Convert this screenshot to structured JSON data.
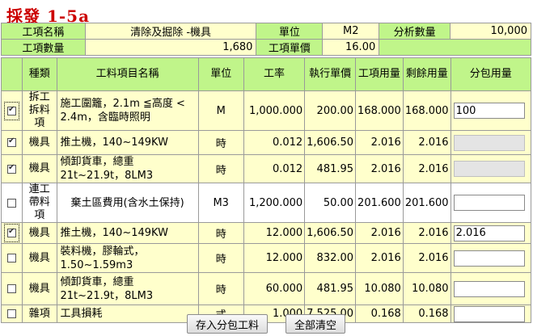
{
  "title": "採發 1-5a",
  "header": {
    "row1": {
      "item_name_label": "工項名稱",
      "item_name": "清除及掘除 -機具",
      "unit_label": "單位",
      "unit": "M2",
      "analysis_qty_label": "分析數量",
      "analysis_qty": "10,000"
    },
    "row2": {
      "item_qty_label": "工項數量",
      "item_qty": "1,680",
      "unit_price_label": "工項單價",
      "unit_price": "16.00"
    }
  },
  "columns": [
    "",
    "種類",
    "工料項目名稱",
    "單位",
    "工率",
    "執行單價",
    "工項用量",
    "剩餘用量",
    "分包用量"
  ],
  "rows": [
    {
      "checked": true,
      "focus": true,
      "kind": "拆工拆料項",
      "name": "施工圍籬，2.1m ≦高度 < 2.4m，含臨時照明",
      "unit": "M",
      "rate": "1,000.000",
      "price": "200.00",
      "usage": "168.000",
      "remain": "168.000",
      "sub": "100",
      "disabled": false,
      "alt": false
    },
    {
      "checked": true,
      "focus": false,
      "kind": "機具",
      "name": "推土機，140~149KW",
      "unit": "時",
      "rate": "0.012",
      "price": "1,606.50",
      "usage": "2.016",
      "remain": "2.016",
      "sub": "",
      "disabled": true,
      "alt": false
    },
    {
      "checked": true,
      "focus": false,
      "kind": "機具",
      "name": "傾卸貨車，總重21t~21.9t，8LM3",
      "unit": "時",
      "rate": "0.012",
      "price": "481.95",
      "usage": "2.016",
      "remain": "2.016",
      "sub": "",
      "disabled": true,
      "alt": false
    },
    {
      "checked": false,
      "focus": false,
      "kind": "連工帶料項",
      "name": "棄土區費用(含水土保持)",
      "unit": "M3",
      "rate": "1,200.000",
      "price": "50.00",
      "usage": "201.600",
      "remain": "201.600",
      "sub": "",
      "disabled": false,
      "alt": true,
      "center": true
    },
    {
      "checked": true,
      "focus": true,
      "kind": "機具",
      "name": "推土機，140~149KW",
      "unit": "時",
      "rate": "12.000",
      "price": "1,606.50",
      "usage": "2.016",
      "remain": "2.016",
      "sub": "2.016",
      "disabled": false,
      "alt": false
    },
    {
      "checked": false,
      "focus": false,
      "kind": "機具",
      "name": "裝料機，膠輪式，1.50~1.59m3",
      "unit": "時",
      "rate": "12.000",
      "price": "832.00",
      "usage": "2.016",
      "remain": "2.016",
      "sub": "",
      "disabled": false,
      "alt": false
    },
    {
      "checked": false,
      "focus": false,
      "kind": "機具",
      "name": "傾卸貨車，總重21t~21.9t，8LM3",
      "unit": "時",
      "rate": "60.000",
      "price": "481.95",
      "usage": "10.080",
      "remain": "10.080",
      "sub": "",
      "disabled": false,
      "alt": false
    },
    {
      "checked": false,
      "focus": false,
      "kind": "雜項",
      "name": "工具損耗",
      "unit": "式",
      "rate": "1.000",
      "price": "7,525.00",
      "usage": "0.168",
      "remain": "0.168",
      "sub": "",
      "disabled": false,
      "alt": false
    }
  ],
  "buttons": {
    "save": "存入分包工料",
    "clear": "全部清空"
  }
}
